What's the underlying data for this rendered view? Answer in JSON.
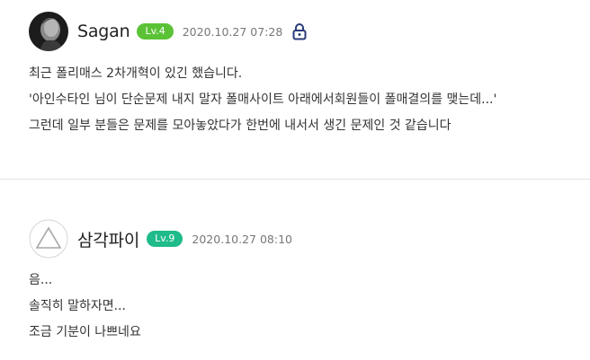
{
  "comments": [
    {
      "nickname": "Sagan",
      "level": "Lv.4",
      "level_color": "#5bc236",
      "timestamp": "2020.10.27 07:28",
      "lock_icon": "lock-icon",
      "lines": [
        "최근 폴리매스 2차개혁이 있긴 했습니다.",
        "'아인수타인 님이 단순문제 내지 말자 폴매사이트 아래에서회원들이  폴매결의를 맺는데...'",
        "그런데 일부 분들은 문제를 모아놓았다가 한번에 내서서 생긴 문제인 것 같습니다"
      ]
    },
    {
      "nickname": "삼각파이",
      "level": "Lv.9",
      "level_color": "#1fbb8a",
      "timestamp": "2020.10.27 08:10",
      "lines": [
        "음...",
        "솔직히 말하자면...",
        "조금 기분이 나쁘네요"
      ]
    }
  ],
  "colors": {
    "lock": "#2a3a7a",
    "divider": "#e2e2e2"
  }
}
